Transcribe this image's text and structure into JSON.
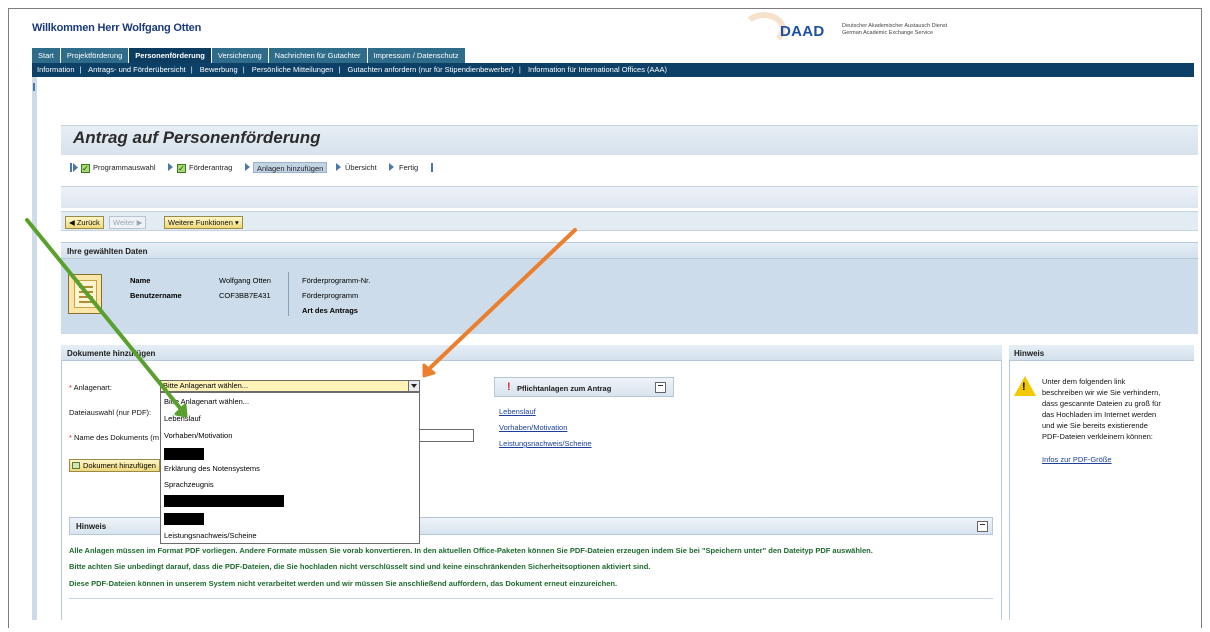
{
  "header": {
    "welcome": "Willkommen Herr Wolfgang Otten",
    "logo_text": "DAAD",
    "logo_line1": "Deutscher Akademischer Austausch Dienst",
    "logo_line2": "German Academic Exchange Service"
  },
  "tabs": [
    {
      "label": "Start"
    },
    {
      "label": "Projektförderung"
    },
    {
      "label": "Personenförderung"
    },
    {
      "label": "Versicherung"
    },
    {
      "label": "Nachrichten für Gutachter"
    },
    {
      "label": "Impressum / Datenschutz"
    }
  ],
  "subnav": [
    {
      "label": "Information"
    },
    {
      "label": "Antrags- und Förderübersicht"
    },
    {
      "label": "Bewerbung"
    },
    {
      "label": "Persönliche Mitteilungen"
    },
    {
      "label": "Gutachten anfordern (nur für Stipendienbewerber)"
    },
    {
      "label": "Information für International Offices (AAA)"
    }
  ],
  "page_title": "Antrag auf Personenförderung",
  "roadmap": [
    {
      "label": "Programmauswahl"
    },
    {
      "label": "Förderantrag"
    },
    {
      "label": "Anlagen hinzufügen"
    },
    {
      "label": "Übersicht"
    },
    {
      "label": "Fertig"
    }
  ],
  "toolbar": {
    "back": "◀ Zurück",
    "next": "Weiter ▶",
    "more": "Weitere Funktionen ▾"
  },
  "data_panel": {
    "title": "Ihre gewählten Daten",
    "name_label": "Name",
    "name_value": "Wolfgang Otten",
    "user_label": "Benutzername",
    "user_value": "COF3BB7E431",
    "prog_nr_label": "Förderprogramm-Nr.",
    "prog_label": "Förderprogramm",
    "type_label": "Art des Antrags"
  },
  "documents": {
    "title": "Dokumente hinzufügen",
    "type_label": "Anlagenart:",
    "file_label": "Dateiauswahl (nur PDF):",
    "docname_label": "Name des Dokuments (m",
    "select_value": "Bitte Anlagenart wählen...",
    "add_button": "Dokument hinzufügen",
    "dropdown_options": [
      "Bitte Anlagenart wählen...",
      "Lebenslauf",
      "Vorhaben/Motivation",
      "",
      "Erklärung des Notensystems",
      "Sprachzeugnis",
      "",
      "",
      "Leistungsnachweis/Scheine"
    ]
  },
  "pflicht": {
    "title": "Pflichtanlagen zum Antrag",
    "links": [
      "Lebenslauf",
      "Vorhaben/Motivation",
      "Leistungsnachweis/Scheine"
    ]
  },
  "hint": {
    "title": "Hinweis",
    "lines": [
      "Alle Anlagen müssen im Format PDF vorliegen. Andere Formate müssen Sie vorab konvertieren. In den aktuellen Office-Paketen können Sie PDF-Dateien erzeugen indem Sie bei \"Speichern unter\" den Dateityp PDF auswählen.",
      "Bitte achten Sie unbedingt darauf, dass die PDF-Dateien, die Sie hochladen nicht verschlüsselt sind und keine einschränkenden Sicherheitsoptionen aktiviert sind.",
      "Diese PDF-Dateien können in unserem System nicht verarbeitet werden und wir müssen Sie anschließend auffordern, das Dokument erneut einzureichen."
    ]
  },
  "right_panel": {
    "title": "Hinweis",
    "lines": [
      "Unter dem folgenden link",
      "beschreiben wir wie Sie verhindern,",
      "dass gescannte Dateien zu groß für",
      "das Hochladen im Internet werden",
      "und wie Sie bereits existierende",
      "PDF-Dateien verkleinern können:"
    ],
    "link": "Infos zur PDF-Größe"
  },
  "colors": {
    "nav_dark": "#0c4066",
    "tab_active": "#0c3c60",
    "hint_green": "#1e6a2e",
    "annotation_green": "#5aa02c",
    "annotation_orange": "#ec7f2e"
  }
}
